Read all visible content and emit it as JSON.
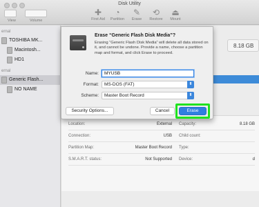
{
  "window": {
    "title": "Disk Utility"
  },
  "toolbar": {
    "left_labels": [
      "View",
      "Volume"
    ],
    "tools": [
      {
        "label": "First Aid",
        "icon": "stethoscope-icon",
        "glyph": "✚"
      },
      {
        "label": "Partition",
        "icon": "partition-icon",
        "glyph": "◔"
      },
      {
        "label": "Erase",
        "icon": "erase-icon",
        "glyph": "✎"
      },
      {
        "label": "Restore",
        "icon": "restore-icon",
        "glyph": "⟲"
      },
      {
        "label": "Mount",
        "icon": "mount-icon",
        "glyph": "⏏"
      }
    ]
  },
  "sidebar": {
    "internal_header": "ernal",
    "external_header": "ernal",
    "items": [
      {
        "label": "TOSHIBA MK..."
      },
      {
        "label": "Macintosh..."
      },
      {
        "label": "HD1"
      },
      {
        "label": "Generic Flash..."
      },
      {
        "label": "NO NAME"
      }
    ]
  },
  "main": {
    "capacity_badge": "8.18 GB",
    "info": [
      {
        "k": "Location:",
        "v": "External",
        "k2": "Capacity:",
        "v2": "8.18 GB"
      },
      {
        "k": "Connection:",
        "v": "USB",
        "k2": "Child count:",
        "v2": ""
      },
      {
        "k": "Partition Map:",
        "v": "Master Boot Record",
        "k2": "Type:",
        "v2": ""
      },
      {
        "k": "S.M.A.R.T. status:",
        "v": "Not Supported",
        "k2": "Device:",
        "v2": "d"
      }
    ]
  },
  "dialog": {
    "title": "Erase “Generic Flash Disk Media”?",
    "description": "Erasing “Generic Flash Disk Media” will delete all data stored on it, and cannot be undone. Provide a name, choose a partition map and format, and click Erase to proceed.",
    "name_label": "Name:",
    "name_value": "MYUSB",
    "format_label": "Format:",
    "format_value": "MS-DOS (FAT)",
    "scheme_label": "Scheme:",
    "scheme_value": "Master Boot Record",
    "security_button": "Security Options...",
    "cancel_button": "Cancel",
    "erase_button": "Erase",
    "highlight_color": "#1fe21f"
  }
}
